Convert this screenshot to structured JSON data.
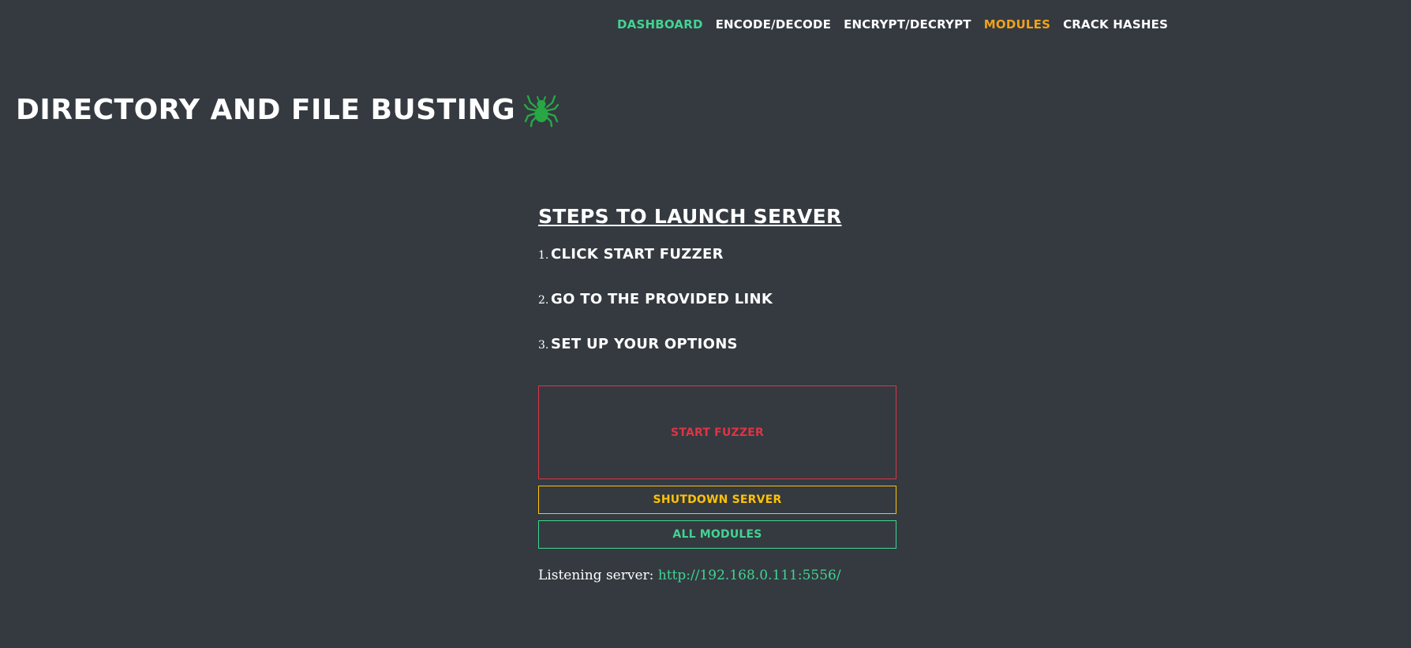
{
  "nav": {
    "items": [
      {
        "label": "DASHBOARD",
        "color": "#42d392"
      },
      {
        "label": "ENCODE/DECODE",
        "color": "#ffffff"
      },
      {
        "label": "ENCRYPT/DECRYPT",
        "color": "#ffffff"
      },
      {
        "label": "MODULES",
        "color": "#f0a21a"
      },
      {
        "label": "CRACK HASHES",
        "color": "#ffffff"
      }
    ]
  },
  "page": {
    "title": "DIRECTORY AND FILE BUSTING",
    "title_icon": "spider-icon",
    "icon_color": "#28a745"
  },
  "steps": {
    "heading": "STEPS TO LAUNCH SERVER",
    "items": [
      {
        "num": "1.",
        "text": "CLICK START FUZZER"
      },
      {
        "num": "2.",
        "text": "GO TO THE PROVIDED LINK"
      },
      {
        "num": "3.",
        "text": "SET UP YOUR OPTIONS"
      }
    ]
  },
  "buttons": {
    "start": "START FUZZER",
    "shutdown": "SHUTDOWN SERVER",
    "modules": "ALL MODULES"
  },
  "server": {
    "label": "Listening server:",
    "url": "http://192.168.0.111:5556/"
  },
  "colors": {
    "background": "#343a40",
    "danger": "#dc3545",
    "warning": "#ffc107",
    "success": "#42d392"
  }
}
